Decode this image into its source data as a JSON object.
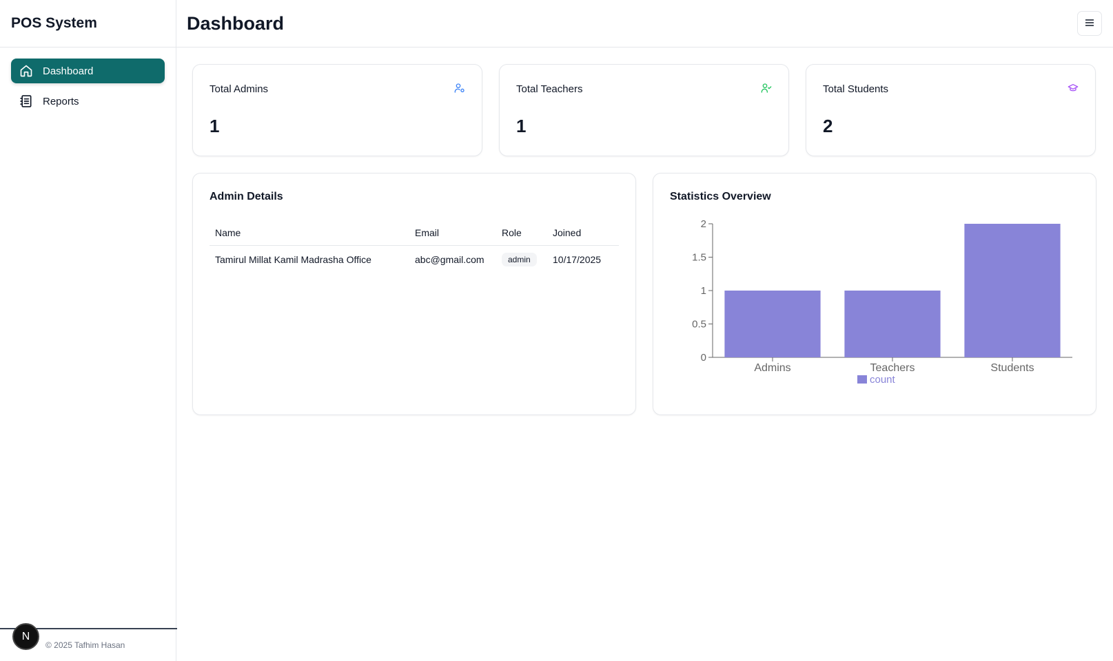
{
  "sidebar": {
    "brand": "POS System",
    "items": [
      {
        "label": "Dashboard",
        "icon": "home-icon",
        "active": true
      },
      {
        "label": "Reports",
        "icon": "reports-icon",
        "active": false
      }
    ],
    "footer_text": "© 2025 Tafhim Hasan",
    "badge_letter": "N"
  },
  "header": {
    "title": "Dashboard",
    "menu_icon": "menu-icon"
  },
  "stats": [
    {
      "label": "Total Admins",
      "value": "1",
      "icon": "users-gear-icon",
      "color": "#3b82f6"
    },
    {
      "label": "Total Teachers",
      "value": "1",
      "icon": "user-check-icon",
      "color": "#22c55e"
    },
    {
      "label": "Total Students",
      "value": "2",
      "icon": "graduation-cap-icon",
      "color": "#a855f7"
    }
  ],
  "admin_details": {
    "title": "Admin Details",
    "columns": [
      "Name",
      "Email",
      "Role",
      "Joined"
    ],
    "rows": [
      {
        "name": "Tamirul Millat Kamil Madrasha Office",
        "email": "abc@gmail.com",
        "role": "admin",
        "joined": "10/17/2025"
      }
    ]
  },
  "statistics": {
    "title": "Statistics Overview"
  },
  "chart_data": {
    "type": "bar",
    "categories": [
      "Admins",
      "Teachers",
      "Students"
    ],
    "series": [
      {
        "name": "count",
        "values": [
          1,
          1,
          2
        ]
      }
    ],
    "ylim": [
      0,
      2
    ],
    "yticks": [
      "0",
      "0.5",
      "1",
      "1.5",
      "2"
    ],
    "bar_color": "#8884d8",
    "legend": "bottom-center",
    "grid": false
  }
}
